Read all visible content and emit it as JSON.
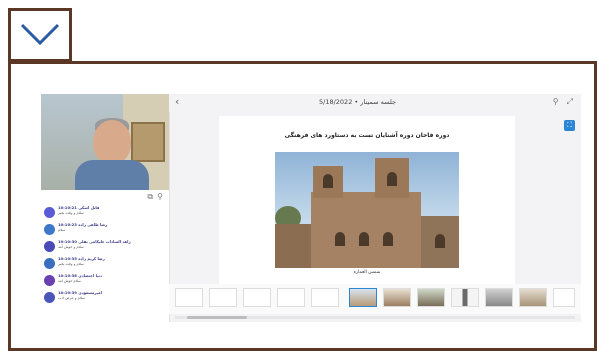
{
  "viewer": {
    "top_bar": {
      "title": "5/18/2022 • جلسه سمینار",
      "back_icon": "chevron-left-icon",
      "search_icon": "search-icon",
      "expand_icon": "expand-icon"
    },
    "slide": {
      "title": "دوره فاخان دوره آشنایان تست به دستاورد های فرهنگی",
      "caption": "شمس العماره"
    }
  },
  "chat": {
    "messages": [
      {
        "name": "فاتل اسکی 10:10:21",
        "text": "سلام و وقت بخیر",
        "color": "#5b5bd6"
      },
      {
        "name": "رضا طاهی زاده 10:10:23",
        "text": "سلام",
        "color": "#3f78c9"
      },
      {
        "name": "زاهد السادات علیکامی نفلی 10:10:30",
        "text": "سلام و خوش آمد",
        "color": "#4b4bb8"
      },
      {
        "name": "رضا کریم زاده 10:10:35",
        "text": "سلام و وقت بخیر",
        "color": "#3a6fc0"
      },
      {
        "name": "دنیا اعتضادی 10:10:38",
        "text": "سلام خوش امد",
        "color": "#6a3fb0"
      },
      {
        "name": "امیرمسعودی 10:10:39",
        "text": "سلام و عرض ادب",
        "color": "#4a57b8"
      }
    ]
  },
  "colors": {
    "frame_border": "#5a3825",
    "accent_blue": "#2c86d6"
  },
  "icons": {
    "toggle": "chevron-down-icon"
  }
}
